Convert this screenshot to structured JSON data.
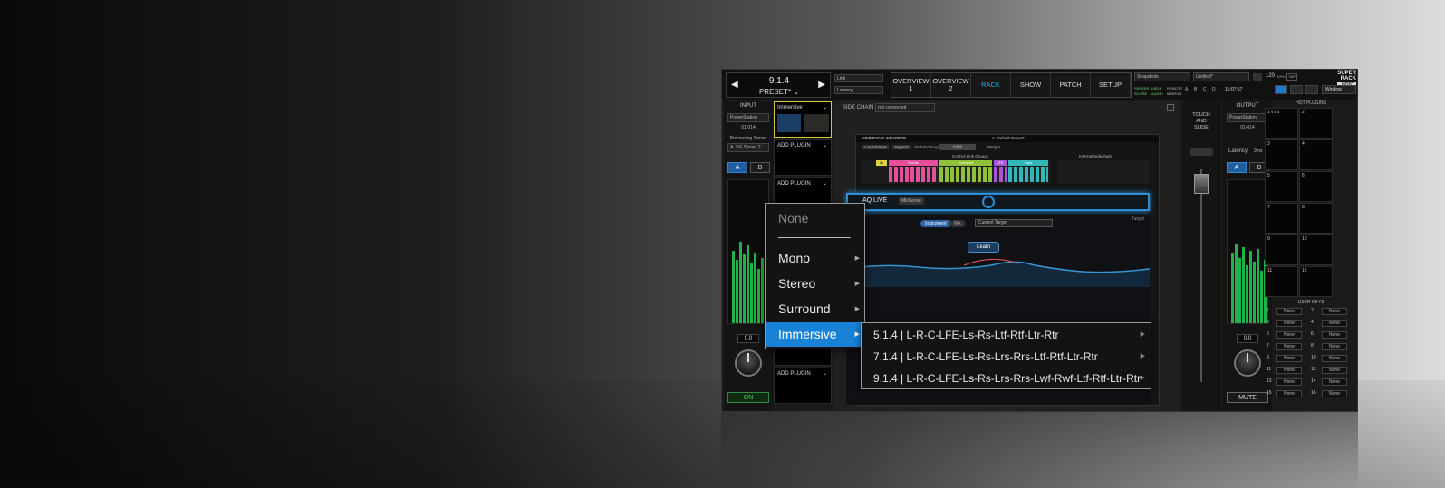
{
  "app": {
    "preset": {
      "name": "9.1.4",
      "label": "PRESET*"
    },
    "top_selects": [
      "Link",
      "Latency"
    ],
    "nav_tabs": [
      {
        "label": "OVERVIEW 1",
        "active": false
      },
      {
        "label": "OVERVIEW 2",
        "active": false
      },
      {
        "label": "RACK",
        "active": true
      },
      {
        "label": "SHOW",
        "active": false
      },
      {
        "label": "PATCH",
        "active": false
      },
      {
        "label": "SETUP",
        "active": false
      }
    ],
    "snapshots": "Snapshots",
    "untitled": "Untitled*",
    "bpm": "120",
    "bpm_label": "BPM",
    "tap": "TAP",
    "time": "15:07:57",
    "status_tiny": [
      "SERVER",
      "SCORE",
      "KBD4",
      "AUDIO",
      "REMOTE",
      "MIRROR"
    ],
    "abcd": [
      "A",
      "B",
      "C",
      "D"
    ],
    "logo_lines": [
      "SUPER",
      "RACK"
    ],
    "logo_badge": "HOST",
    "window_btn": "Window",
    "accent": "#2fa6f0"
  },
  "input": {
    "title": "INPUT",
    "device": "PowerStation",
    "channels": "01-014",
    "processing_label": "Processing Server",
    "server": "A. SG Server 2",
    "a": "A",
    "b": "B",
    "value": "0.0",
    "on_label": "ON"
  },
  "slots": {
    "first": "Immersive",
    "add_plugin": "ADD PLUGIN"
  },
  "center": {
    "side_chain_label": "SIDE CHAIN",
    "side_chain_value": "not connected",
    "wrapper_title": "IMMERSIVE WRAPPER",
    "default_preset": "A. Default Preset*",
    "load_preset": "Load Preset",
    "bypass": "Bypass",
    "global_group": "Global Group",
    "none": "none",
    "weight": "Weight",
    "control_link_groups": "Control Link Groups",
    "internal_sidechain": "Internal Sidechain",
    "groups": [
      "All",
      "Fronts",
      "Surround",
      "LFE",
      "Tops"
    ],
    "aq_title": "AQ LIVE",
    "misense": "MixSense",
    "instrument": "Instrument",
    "mix": "Mix",
    "current_target": "Current Target",
    "learn": "Learn",
    "target": "Target"
  },
  "menu": {
    "items": [
      "None",
      "Mono",
      "Stereo",
      "Surround",
      "Immersive"
    ],
    "selected": "Immersive",
    "submenu": [
      "5.1.4 | L-R-C-LFE-Ls-Rs-Ltf-Rtf-Ltr-Rtr",
      "7.1.4 | L-R-C-LFE-Ls-Rs-Lrs-Rrs-Ltf-Rtf-Ltr-Rtr",
      "9.1.4 | L-R-C-LFE-Ls-Rs-Lrs-Rrs-Lwf-Rwf-Ltf-Rtf-Ltr-Rtr"
    ]
  },
  "touch": {
    "label_lines": [
      "TOUCH",
      "AND",
      "SLIDE"
    ]
  },
  "output": {
    "title": "OUTPUT",
    "device": "PowerStation",
    "channels": "01-014",
    "latency_label": "Latency",
    "latency_value": "9ms",
    "a": "A",
    "b": "B",
    "value": "0.0",
    "mute_label": "MUTE"
  },
  "hot_plugins": {
    "title": "HOT PLUGINS",
    "cells": [
      "1",
      "2",
      "3",
      "4",
      "5",
      "6",
      "7",
      "8",
      "9",
      "10",
      "11",
      "12"
    ],
    "first_cell_text": "9.1.4"
  },
  "user_keys": {
    "title": "USER KEYS",
    "rows": [
      [
        "1",
        "None",
        "2",
        "None"
      ],
      [
        "3",
        "None",
        "4",
        "None"
      ],
      [
        "5",
        "None",
        "6",
        "None"
      ],
      [
        "7",
        "None",
        "8",
        "None"
      ],
      [
        "9",
        "None",
        "10",
        "None"
      ],
      [
        "11",
        "None",
        "12",
        "None"
      ],
      [
        "13",
        "None",
        "14",
        "None"
      ],
      [
        "15",
        "None",
        "16",
        "None"
      ]
    ]
  }
}
